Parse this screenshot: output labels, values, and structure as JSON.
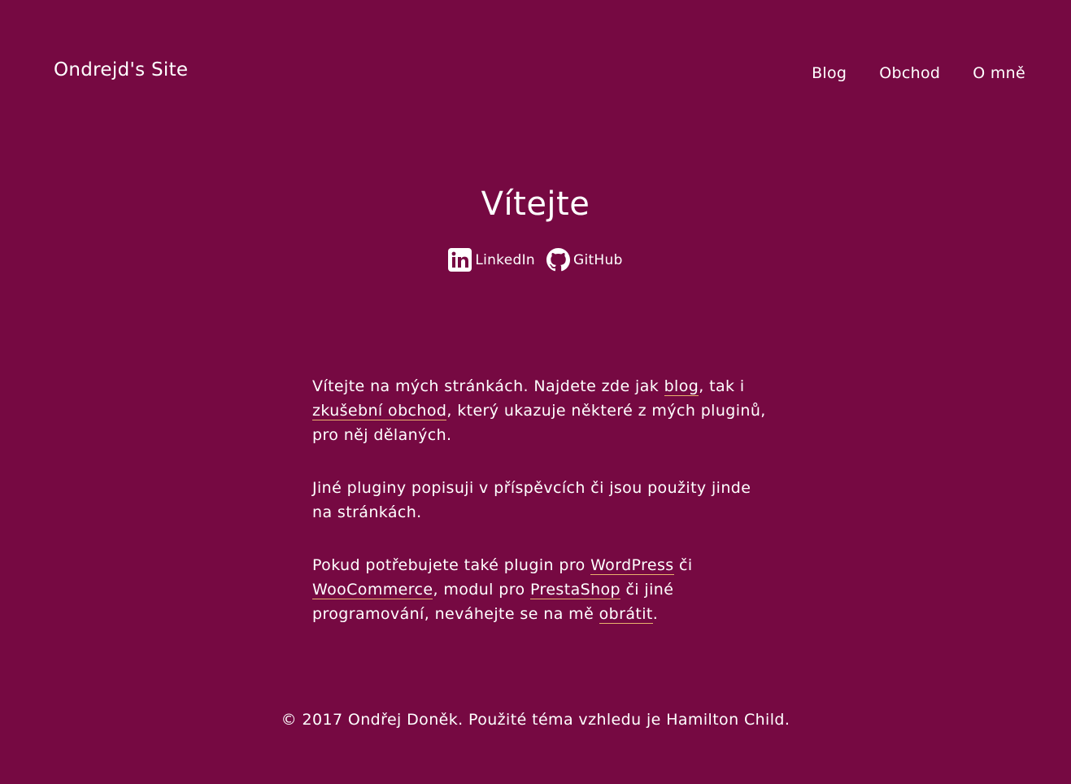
{
  "header": {
    "site_title": "Ondrejd's Site",
    "nav": [
      {
        "label": "Blog"
      },
      {
        "label": "Obchod"
      },
      {
        "label": "O mně"
      }
    ]
  },
  "hero": {
    "title": "Vítejte",
    "social": [
      {
        "label": "LinkedIn",
        "icon": "linkedin-icon"
      },
      {
        "label": "GitHub",
        "icon": "github-icon"
      }
    ]
  },
  "content": {
    "p1": {
      "t1": "Vítejte na mých stránkách. Najdete zde jak ",
      "link_blog": "blog",
      "t2": ", tak i ",
      "link_shop": "zkušební obchod",
      "t3": ", který ukazuje některé z mých pluginů, pro něj dělaných."
    },
    "p2": {
      "text": "Jiné pluginy popisuji v příspěvcích či jsou použity jinde na stránkách."
    },
    "p3": {
      "t1": "Pokud potřebujete také plugin pro ",
      "link_wordpress": "WordPress",
      "t2": " či ",
      "link_woocommerce": "WooCommerce",
      "t3": ", modul pro ",
      "link_prestashop": "PrestaShop",
      "t4": " či jiné programování, neváhejte se na mě ",
      "link_contact": "obrátit",
      "t5": "."
    }
  },
  "footer": {
    "text": "© 2017 Ondřej Doněk. Použité téma vzhledu je Hamilton Child."
  },
  "colors": {
    "background": "#760942",
    "text": "#ffffff",
    "link_underline": "#e8b26d"
  }
}
